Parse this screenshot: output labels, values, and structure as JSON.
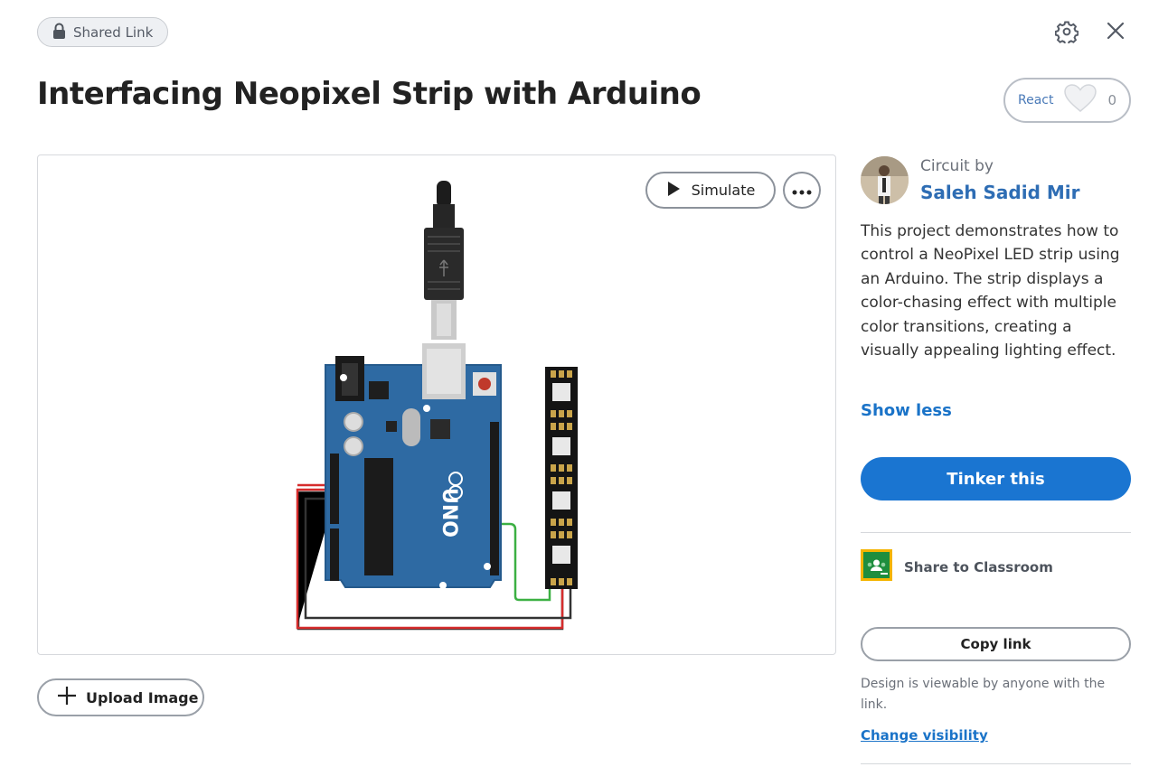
{
  "header": {
    "shared_label": "Shared Link",
    "title": "Interfacing Neopixel Strip with Arduino",
    "react_label": "React",
    "react_count": "0"
  },
  "canvas": {
    "simulate_label": "Simulate"
  },
  "upload_label": "Upload Image",
  "author": {
    "prefix": "Circuit by",
    "name": "Saleh Sadid Mir"
  },
  "description": "This project demonstrates how to control a NeoPixel LED strip using an Arduino. The strip displays a color-chasing effect with multiple color transitions, creating a visually appealing lighting effect.",
  "show_less": "Show less",
  "tinker_label": "Tinker this",
  "classroom_label": "Share to Classroom",
  "copy_link_label": "Copy link",
  "visibility_note": "Design is viewable by anyone with the link.",
  "change_visibility": "Change visibility",
  "colors": {
    "primary": "#1a75d1",
    "link": "#2e6db4",
    "arduino_board": "#2d6aa0",
    "wire_red": "#e03030",
    "wire_black": "#333333",
    "wire_green": "#3cb043"
  },
  "icons": {
    "lock": "lock-icon",
    "gear": "gear-icon",
    "close": "close-icon",
    "heart": "heart-icon",
    "play": "play-icon",
    "more": "more-icon",
    "plus": "plus-icon",
    "classroom": "google-classroom-icon"
  }
}
